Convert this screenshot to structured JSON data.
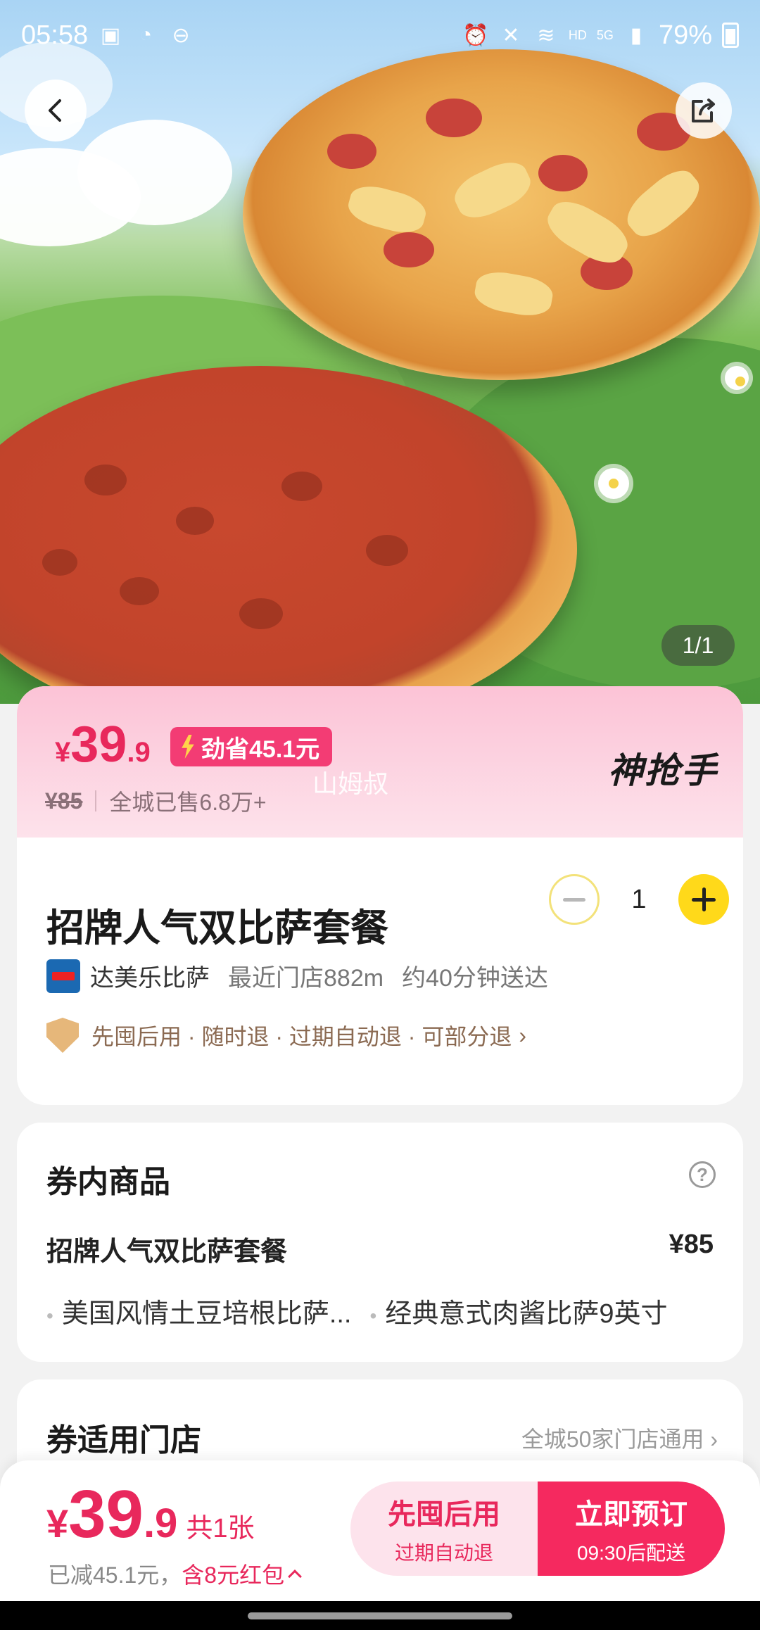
{
  "status_bar": {
    "time": "05:58",
    "battery": "79%",
    "network": "5G",
    "hd": "HD"
  },
  "gallery": {
    "counter": "1/1"
  },
  "promo": {
    "currency": "¥",
    "price_int": "39",
    "price_dec": ".9",
    "save_badge": "劲省45.1元",
    "original_price": "¥85",
    "sold_text": "全城已售6.8万+",
    "brand_mark": "神抢手",
    "watermark": "山姆叔"
  },
  "product": {
    "title": "招牌人气双比萨套餐",
    "quantity": "1",
    "store_name": "达美乐比萨",
    "nearest_store": "最近门店882m",
    "delivery_time": "约40分钟送达",
    "policy": "先囤后用 · 随时退 · 过期自动退 · 可部分退"
  },
  "voucher_items": {
    "title": "券内商品",
    "help": "?",
    "item_name": "招牌人气双比萨套餐",
    "item_price": "¥85",
    "sub_items": [
      "美国风情土豆培根比萨...",
      "经典意式肉酱比萨9英寸"
    ]
  },
  "stores": {
    "title": "券适用门店",
    "link": "全城50家门店通用"
  },
  "bottom_bar": {
    "currency": "¥",
    "price_int": "39",
    "price_dec": ".9",
    "count": "共1张",
    "discount_text": "已减45.1元，",
    "red_packet": "含8元红包",
    "later_main": "先囤后用",
    "later_sub": "过期自动退",
    "book_main": "立即预订",
    "book_sub": "09:30后配送"
  },
  "colors": {
    "accent": "#e8285c",
    "button": "#f5295f",
    "stepper_plus": "#ffd91a"
  }
}
